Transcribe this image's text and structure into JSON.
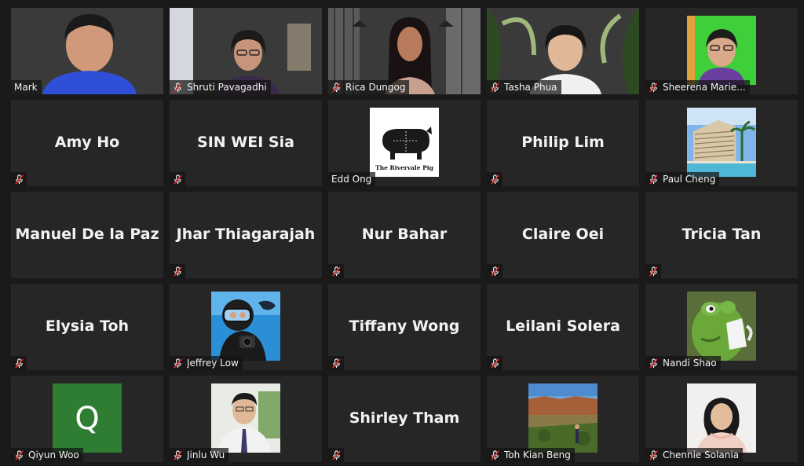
{
  "participants": [
    {
      "name": "Mark",
      "display": "video",
      "muted": false
    },
    {
      "name": "Shruti Pavagadhi",
      "display": "video",
      "muted": true
    },
    {
      "name": "Rica Dungog",
      "display": "video",
      "muted": true
    },
    {
      "name": "Tasha Phua",
      "display": "video",
      "muted": true
    },
    {
      "name": "Sheerena Marie...",
      "display": "avatar",
      "muted": true,
      "avatar": "person-green-bg"
    },
    {
      "name": "Amy Ho",
      "display": "name",
      "muted": true
    },
    {
      "name": "SIN WEI Sia",
      "display": "name",
      "muted": true
    },
    {
      "name": "Edd Ong",
      "display": "avatar",
      "muted": false,
      "avatar": "logo",
      "avatar_text": "The Rivervale Pig"
    },
    {
      "name": "Philip Lim",
      "display": "name",
      "muted": true
    },
    {
      "name": "Paul Cheng",
      "display": "avatar",
      "muted": true,
      "avatar": "hotel-photo"
    },
    {
      "name": "Manuel De la Paz",
      "display": "name",
      "muted": false
    },
    {
      "name": "Jhar Thiagarajah",
      "display": "name",
      "muted": true
    },
    {
      "name": "Nur Bahar",
      "display": "name",
      "muted": true
    },
    {
      "name": "Claire Oei",
      "display": "name",
      "muted": true
    },
    {
      "name": "Tricia Tan",
      "display": "name",
      "muted": true
    },
    {
      "name": "Elysia Toh",
      "display": "name",
      "muted": true
    },
    {
      "name": "Jeffrey Low",
      "display": "avatar",
      "muted": true,
      "avatar": "diver-photo"
    },
    {
      "name": "Tiffany Wong",
      "display": "name",
      "muted": true
    },
    {
      "name": "Leilani Solera",
      "display": "name",
      "muted": true
    },
    {
      "name": "Nandi Shao",
      "display": "avatar",
      "muted": true,
      "avatar": "frog-mug"
    },
    {
      "name": "Qiyun Woo",
      "display": "avatar",
      "muted": true,
      "avatar": "letter",
      "avatar_text": "Q"
    },
    {
      "name": "Jinlu Wu",
      "display": "avatar",
      "muted": true,
      "avatar": "portrait"
    },
    {
      "name": "Shirley Tham",
      "display": "name",
      "muted": true
    },
    {
      "name": "Toh Kian Beng",
      "display": "avatar",
      "muted": true,
      "avatar": "canyon-photo"
    },
    {
      "name": "Chennie Solania",
      "display": "avatar",
      "muted": true,
      "avatar": "selfie"
    }
  ],
  "colors": {
    "background": "#1a1a1a",
    "tile": "#262626",
    "muted_icon": "#e02828",
    "avatar_q": "#2e7d32"
  }
}
